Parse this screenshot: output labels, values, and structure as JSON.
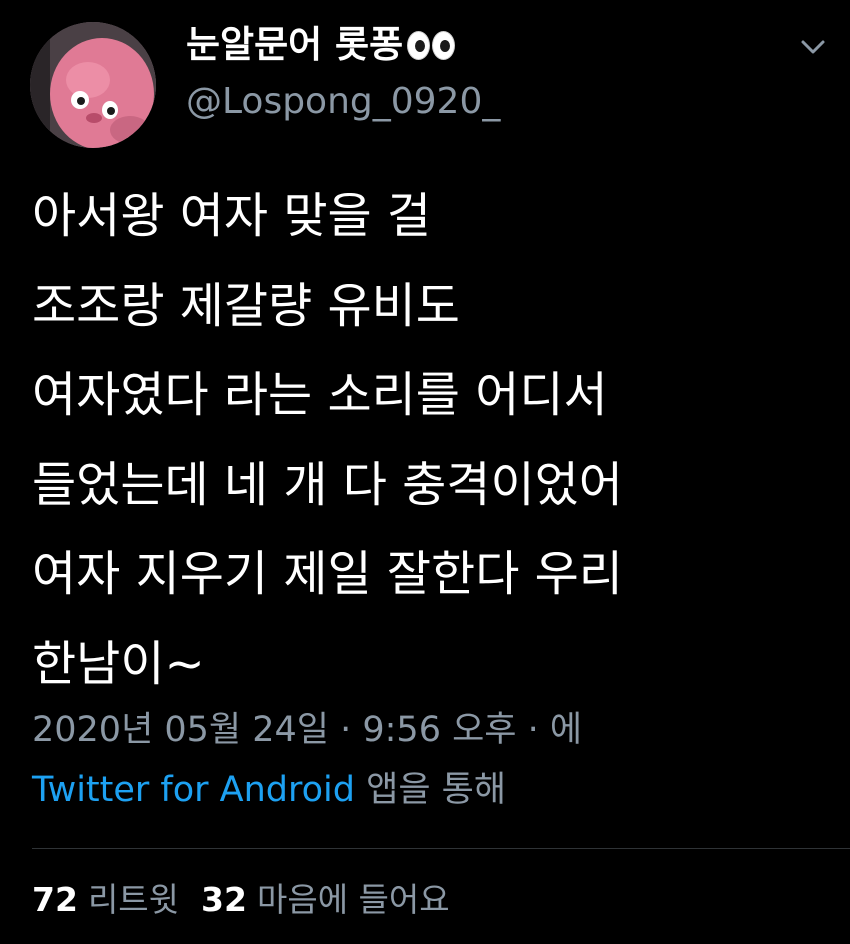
{
  "user": {
    "display_name": "눈알문어 롯퐁",
    "handle": "@Lospong_0920_"
  },
  "icons": {
    "name_emoji": "eyes-emoji",
    "menu": "chevron-down-icon"
  },
  "tweet": {
    "lines": [
      "아서왕 여자 맞을 걸",
      "조조랑 제갈량 유비도",
      "여자였다 라는 소리를 어디서",
      "들었는데 네 개 다 충격이었어",
      "여자 지우기 제일 잘한다 우리",
      "한남이~"
    ],
    "timestamp": "2020년 05월 24일 · 9:56 오후 · 에",
    "source_app": "Twitter for Android",
    "source_suffix": " 앱을 통해"
  },
  "stats": {
    "retweets_count": "72",
    "retweets_label": "리트윗",
    "likes_count": "32",
    "likes_label": "마음에 들어요"
  },
  "colors": {
    "background": "#000000",
    "primary_text": "#ffffff",
    "secondary_text": "#8b98a5",
    "link": "#1da1f2",
    "divider": "#2f3336"
  }
}
